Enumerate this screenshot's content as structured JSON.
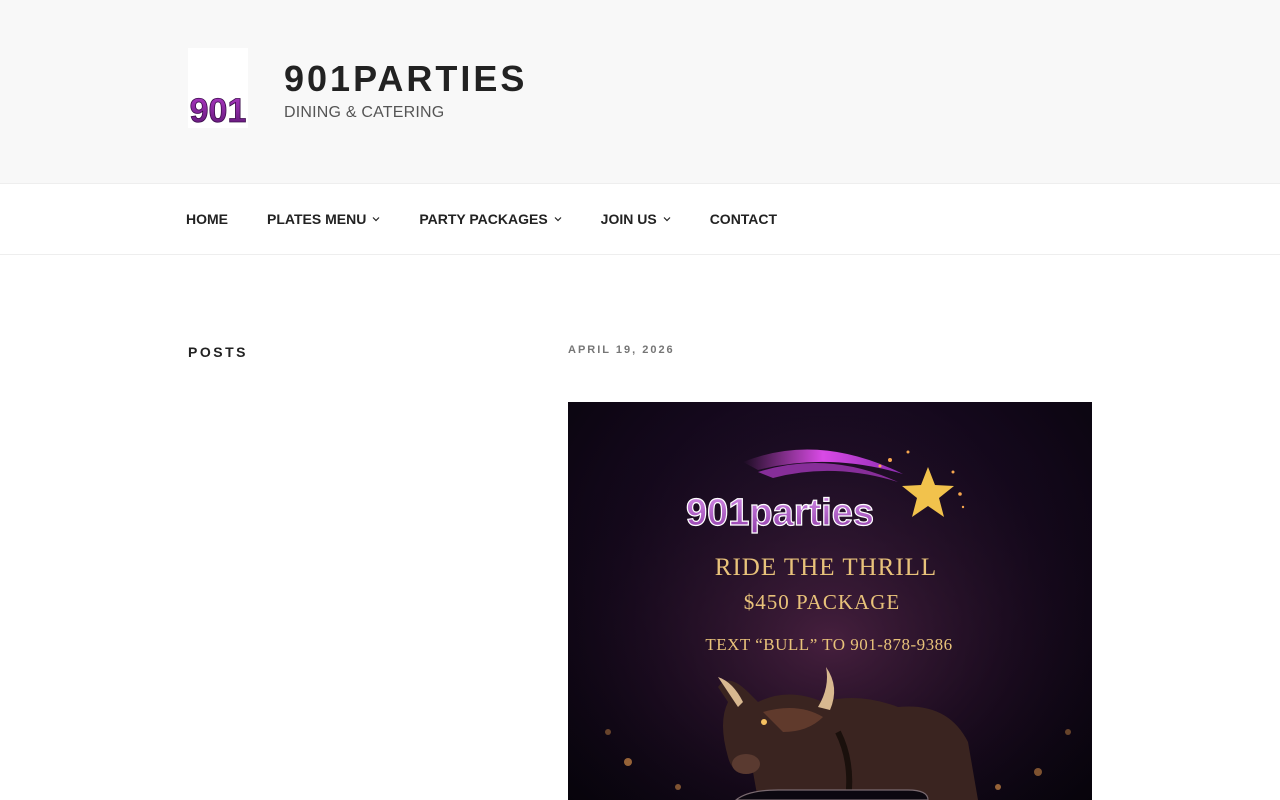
{
  "header": {
    "logo_text": "901",
    "site_title": "901PARTIES",
    "tagline": "DINING & CATERING"
  },
  "nav": {
    "items": [
      {
        "label": "HOME",
        "has_dropdown": false
      },
      {
        "label": "PLATES MENU",
        "has_dropdown": true
      },
      {
        "label": "PARTY PACKAGES",
        "has_dropdown": true
      },
      {
        "label": "JOIN US",
        "has_dropdown": true
      },
      {
        "label": "CONTACT",
        "has_dropdown": false
      }
    ]
  },
  "sidebar": {
    "heading": "POSTS"
  },
  "post": {
    "date": "APRIL 19, 2026",
    "image": {
      "brand": "901parties",
      "headline": "RIDE THE THRILL",
      "price_line": "$450 PACKAGE",
      "cta_line": "TEXT “BULL” TO 901-878-9386"
    }
  },
  "colors": {
    "header_bg": "#f8f8f8",
    "text_dark": "#222222",
    "date_gray": "#767676",
    "promo_gold": "#e8c27a",
    "promo_purple": "#c63fd9"
  }
}
